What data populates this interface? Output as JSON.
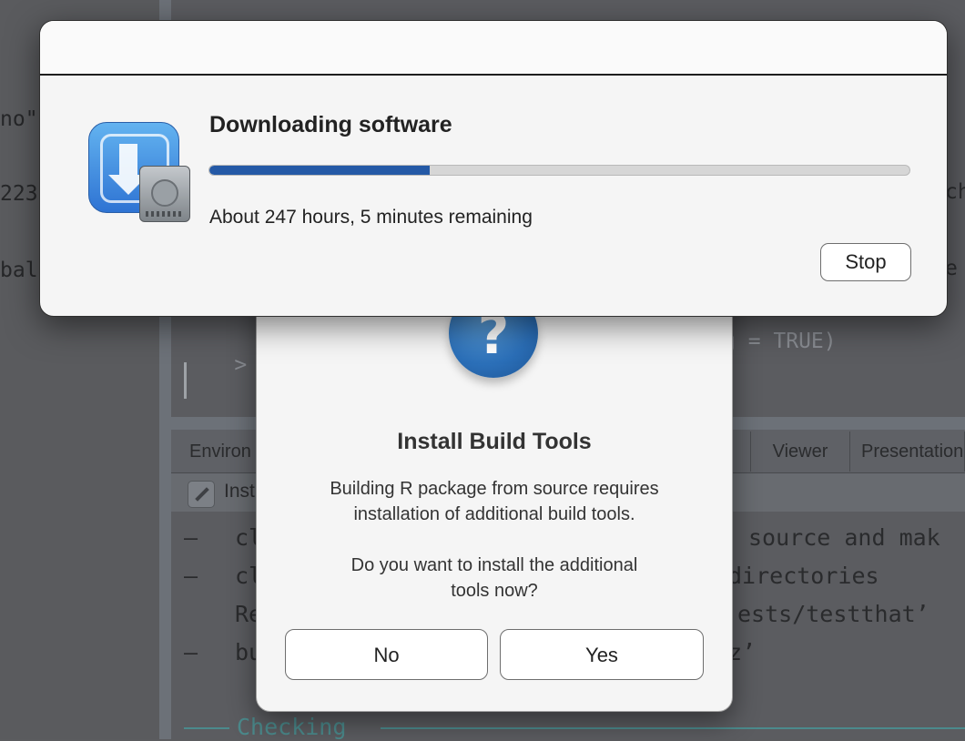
{
  "background": {
    "left_fragments": [
      "no\"",
      "223",
      "bal"
    ],
    "right_fragments": [
      "ch",
      "e"
    ],
    "console_prompt": "> pkg",
    "console_prompt_tail": "g = TRUE)",
    "tabs": [
      "Environ",
      "Viewer",
      "Presentation"
    ],
    "build_pane_label": "Inst",
    "build_output": [
      {
        "bullet": "—",
        "left": "cl",
        "right": "source and mak"
      },
      {
        "bullet": "—",
        "left": "cl",
        "right": "directories"
      },
      {
        "bullet": "",
        "left": "Re",
        "right": "ests/testthat’"
      },
      {
        "bullet": "—",
        "left": "bu",
        "right": "z’"
      }
    ],
    "checking_label": "Checking"
  },
  "install_dialog": {
    "icon": "question-mark-icon",
    "title": "Install Build Tools",
    "message_line1": "Building R package from source requires",
    "message_line2": "installation of additional build tools.",
    "question_line1": "Do you want to install the additional",
    "question_line2": "tools now?",
    "no_label": "No",
    "yes_label": "Yes"
  },
  "download_window": {
    "icon": "installer-package-icon",
    "title": "Downloading software",
    "progress_fraction": 0.315,
    "progress_color": "#2459a6",
    "status": "About 247 hours, 5 minutes remaining",
    "stop_label": "Stop"
  }
}
